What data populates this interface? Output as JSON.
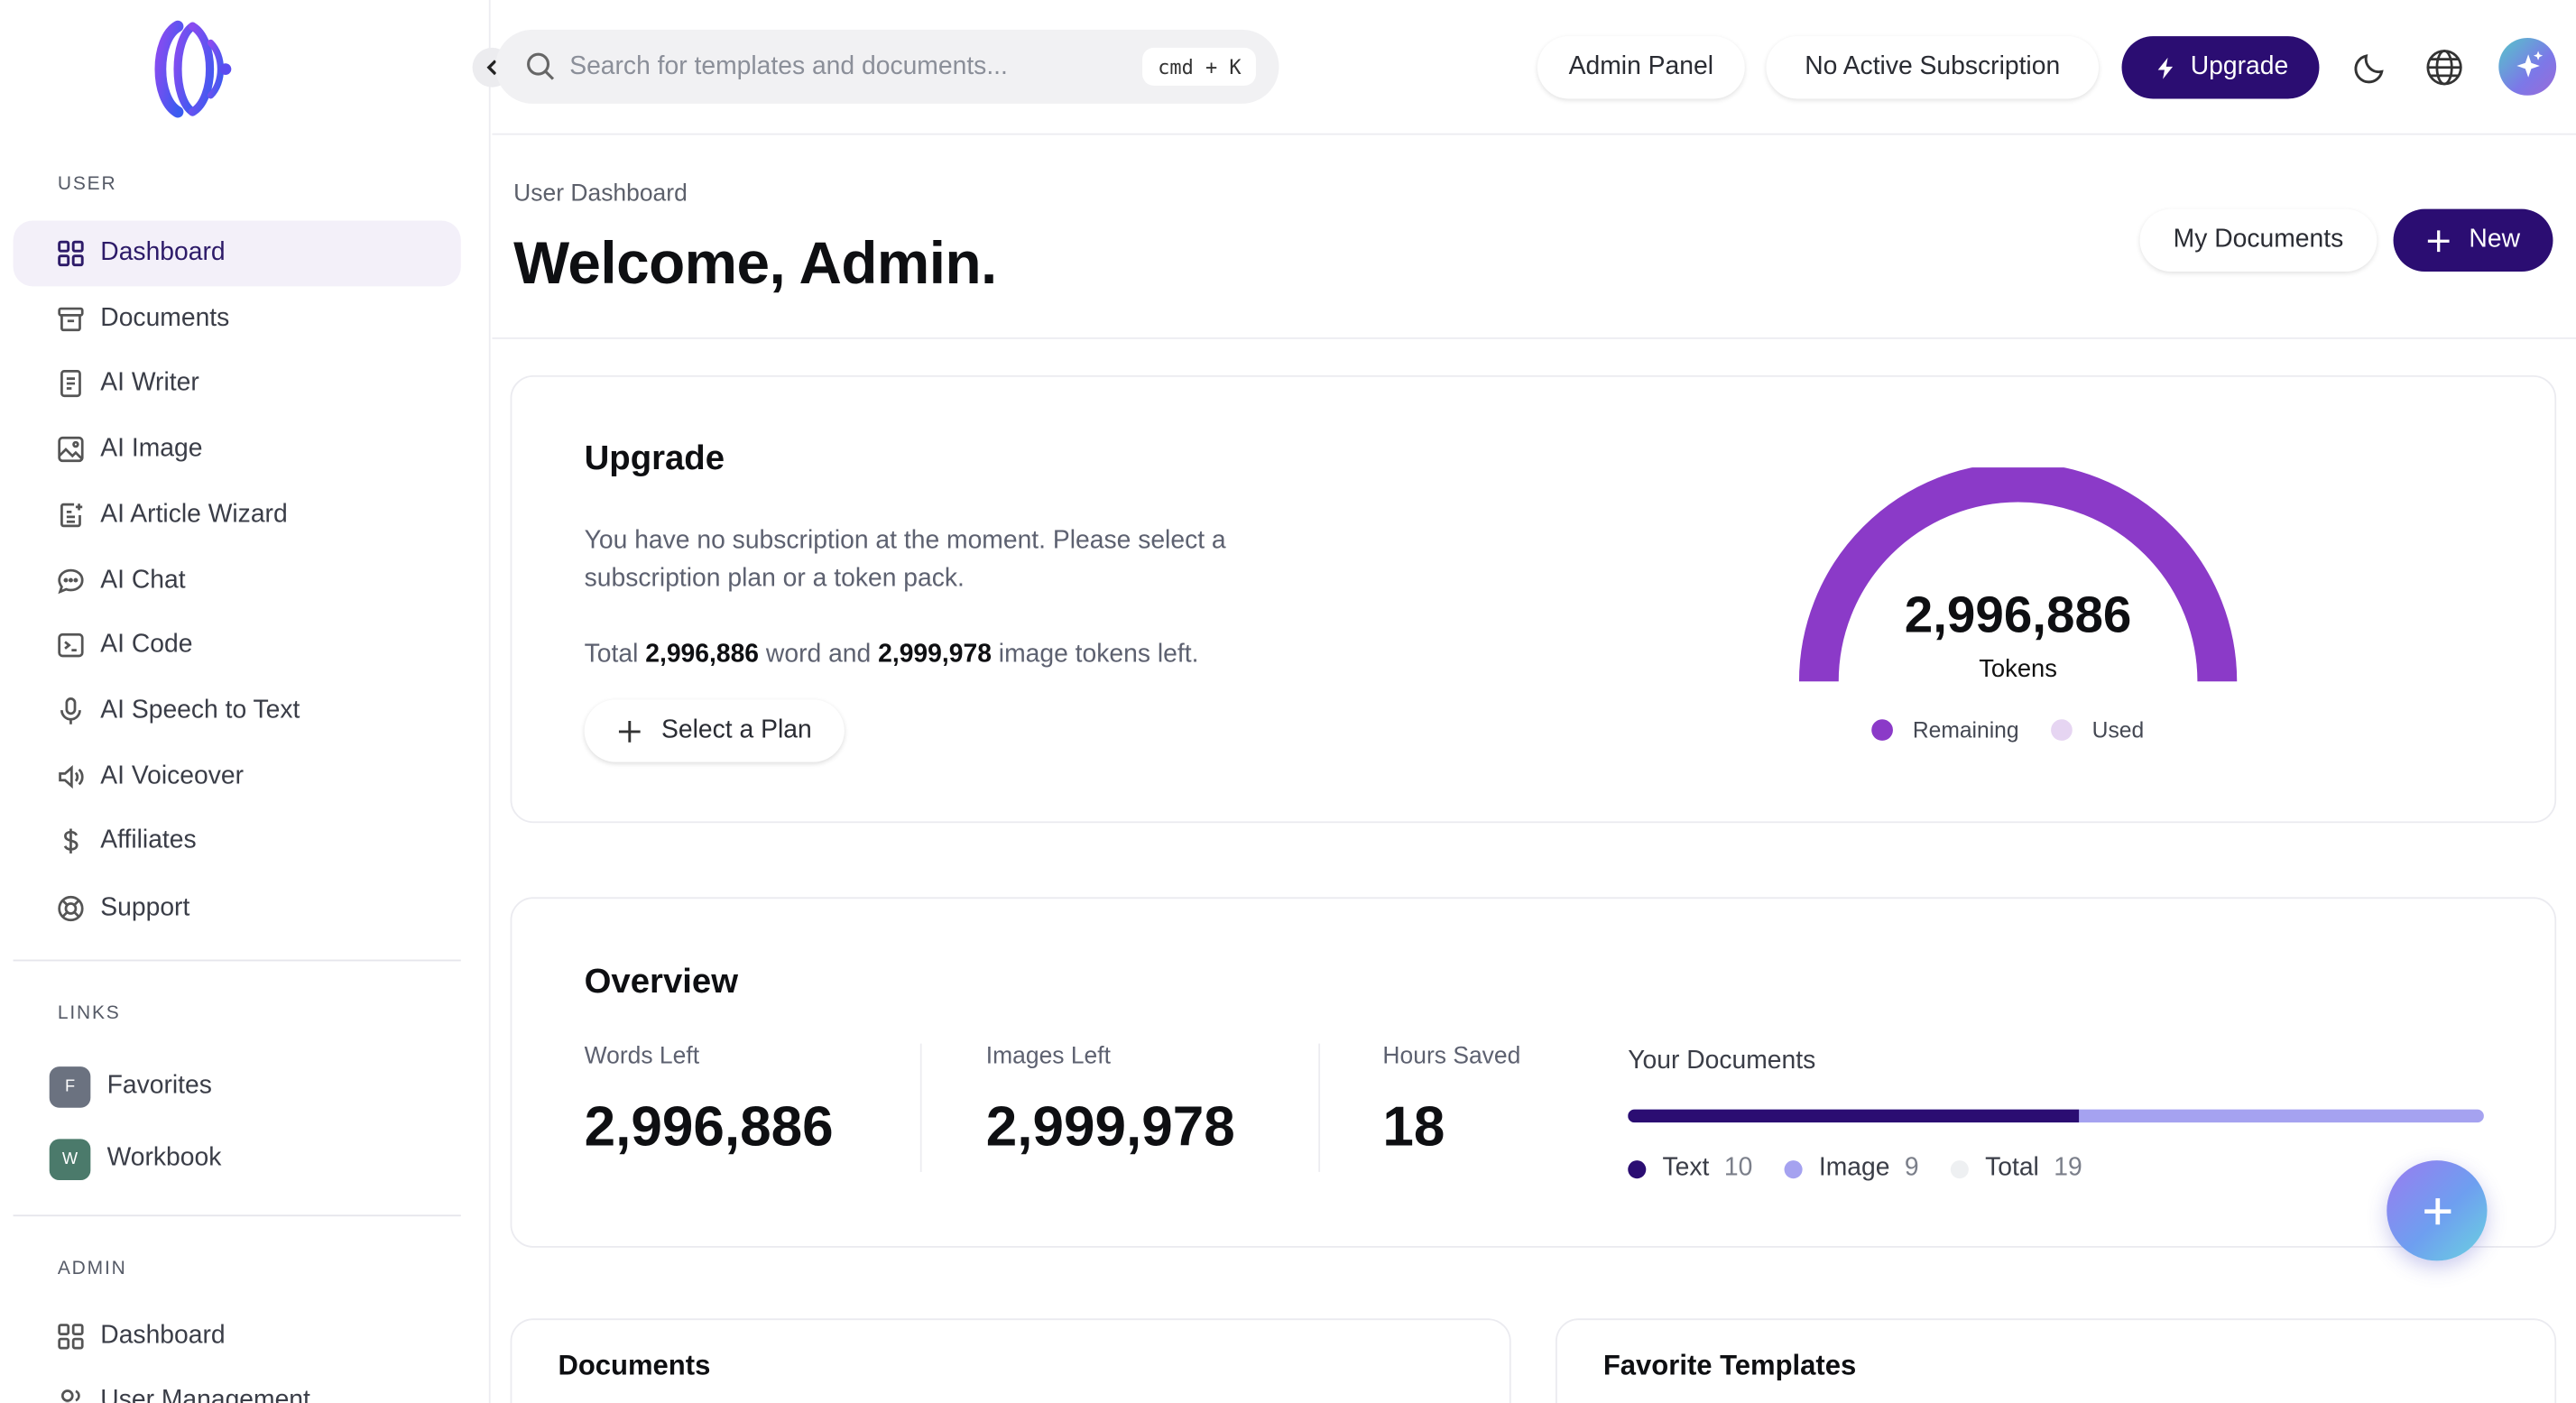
{
  "sidebar": {
    "sections": {
      "user": "USER",
      "links": "LINKS",
      "admin": "ADMIN"
    },
    "user_items": [
      {
        "label": "Dashboard",
        "icon": "grid-icon",
        "active": true
      },
      {
        "label": "Documents",
        "icon": "archive-icon"
      },
      {
        "label": "AI Writer",
        "icon": "document-icon"
      },
      {
        "label": "AI Image",
        "icon": "image-icon"
      },
      {
        "label": "AI Article Wizard",
        "icon": "article-wizard-icon"
      },
      {
        "label": "AI Chat",
        "icon": "chat-icon"
      },
      {
        "label": "AI Code",
        "icon": "terminal-icon"
      },
      {
        "label": "AI Speech to Text",
        "icon": "microphone-icon"
      },
      {
        "label": "AI Voiceover",
        "icon": "speaker-icon"
      },
      {
        "label": "Affiliates",
        "icon": "dollar-icon"
      },
      {
        "label": "Support",
        "icon": "lifebuoy-icon"
      }
    ],
    "links": [
      {
        "badge": "F",
        "label": "Favorites",
        "color": "#6b7280"
      },
      {
        "badge": "W",
        "label": "Workbook",
        "color": "#4b7a6b"
      }
    ],
    "admin_items": [
      {
        "label": "Dashboard",
        "icon": "grid-icon"
      },
      {
        "label": "User Management",
        "icon": "users-icon"
      }
    ]
  },
  "topbar": {
    "search_placeholder": "Search for templates and documents...",
    "shortcut": "cmd + K",
    "admin_panel": "Admin Panel",
    "subscription_status": "No Active Subscription",
    "upgrade": "Upgrade"
  },
  "header": {
    "breadcrumb": "User Dashboard",
    "title": "Welcome, Admin.",
    "my_documents": "My Documents",
    "new": "New"
  },
  "upgrade_card": {
    "title": "Upgrade",
    "message": "You have no subscription at the moment. Please select a subscription plan or a token pack.",
    "tokens_prefix": "Total",
    "words_left": "2,996,886",
    "tokens_mid": "word and",
    "images_left": "2,999,978",
    "tokens_suffix": "image tokens left.",
    "select_plan": "Select a Plan",
    "gauge": {
      "value": "2,996,886",
      "label": "Tokens",
      "remaining_label": "Remaining",
      "used_label": "Used",
      "remaining_fraction": 1.0,
      "remaining_color": "#8b3ac8",
      "used_color": "#e6d5f2"
    }
  },
  "overview": {
    "title": "Overview",
    "stats": [
      {
        "label": "Words Left",
        "value": "2,996,886"
      },
      {
        "label": "Images Left",
        "value": "2,999,978"
      },
      {
        "label": "Hours Saved",
        "value": "18"
      }
    ],
    "documents": {
      "title": "Your Documents",
      "text_fraction": 0.526,
      "legend": [
        {
          "label": "Text",
          "value": "10",
          "color": "#2b0d72"
        },
        {
          "label": "Image",
          "value": "9",
          "color": "#a5a2f0"
        },
        {
          "label": "Total",
          "value": "19",
          "color": "#eef0f2"
        }
      ]
    }
  },
  "bottom_cards": {
    "documents": "Documents",
    "favorite_templates": "Favorite Templates"
  }
}
